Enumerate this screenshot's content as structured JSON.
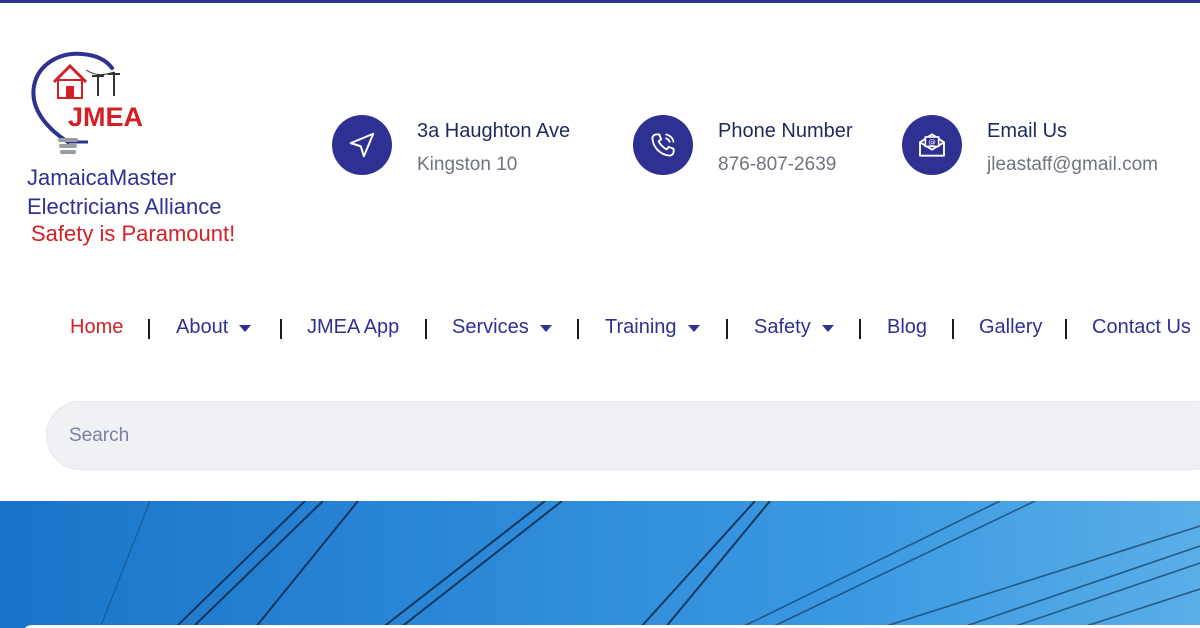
{
  "brand": {
    "logo_text": "JMEA",
    "name_line1": "JamaicaMaster",
    "name_line2": "Electricians Alliance",
    "tagline": "Safety is Paramount!"
  },
  "contacts": [
    {
      "icon": "navigation-arrow-icon",
      "label": "3a Haughton Ave",
      "value": "Kingston 10"
    },
    {
      "icon": "phone-icon",
      "label": "Phone Number",
      "value": "876-807-2639"
    },
    {
      "icon": "envelope-icon",
      "label": "Email Us",
      "value": "jleastaff@gmail.com"
    }
  ],
  "nav": [
    {
      "label": "Home",
      "active": true,
      "dropdown": false
    },
    {
      "label": "About",
      "active": false,
      "dropdown": true
    },
    {
      "label": "JMEA App",
      "active": false,
      "dropdown": false
    },
    {
      "label": "Services",
      "active": false,
      "dropdown": true
    },
    {
      "label": "Training",
      "active": false,
      "dropdown": true
    },
    {
      "label": "Safety",
      "active": false,
      "dropdown": true
    },
    {
      "label": "Blog",
      "active": false,
      "dropdown": false
    },
    {
      "label": "Gallery",
      "active": false,
      "dropdown": false
    },
    {
      "label": "Contact Us",
      "active": false,
      "dropdown": false
    }
  ],
  "search": {
    "placeholder": "Search",
    "value": ""
  },
  "colors": {
    "primary": "#2e3192",
    "accent": "#d32027",
    "muted": "#6f7480",
    "search_bg": "#f0f1f4"
  }
}
